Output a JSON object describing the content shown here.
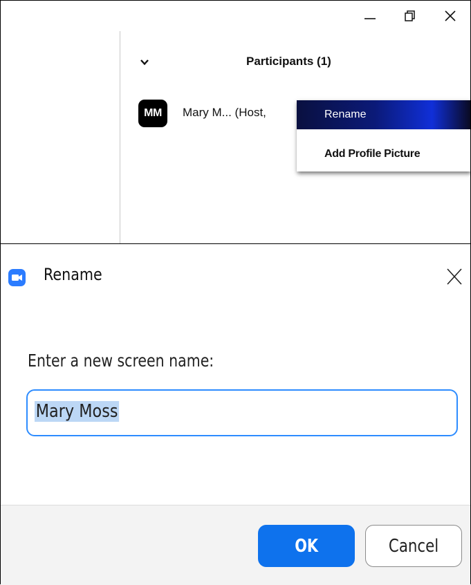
{
  "participants_window": {
    "controls": {
      "minimize_icon": "minimize-icon",
      "restore_icon": "restore-icon",
      "close_icon": "close-icon"
    },
    "panel_title": "Participants (1)",
    "participant": {
      "initials": "MM",
      "name_text": "Mary M... (Host,"
    },
    "context_menu": {
      "items": [
        {
          "label": "Rename",
          "highlighted": true
        },
        {
          "label": "Add Profile Picture",
          "highlighted": false
        }
      ]
    }
  },
  "rename_dialog": {
    "title": "Rename",
    "prompt": "Enter a new screen name:",
    "input_value": "Mary Moss",
    "ok_label": "OK",
    "cancel_label": "Cancel",
    "colors": {
      "accent": "#0e72ed",
      "input_border": "#2d8cff",
      "selection": "#bcd7f5",
      "logo": "#2b7cff"
    }
  }
}
